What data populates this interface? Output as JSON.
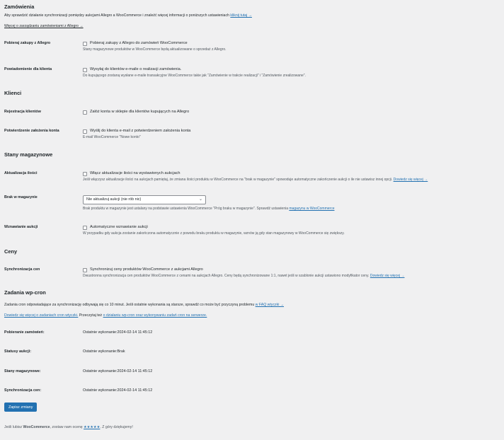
{
  "orders": {
    "title": "Zamówienia",
    "desc": "Aby sprawdzić działanie synchronizacji pomiędzy aukcjami Allegro a WooCommerce i znaleźć więcej informacji o poniższych ustawieniach",
    "desc_link": "kliknij tutaj →",
    "more_link": "Więcej o zarządzaniu zamówieniami z Allegro →",
    "fetch": {
      "label": "Pobieraj zakupy z Allegro",
      "checkbox_label": "Pobieraj zakupy z Allegro do zamówień WooCommerce",
      "help": "Stany magazynowe produktów w WooCommerce będą aktualizowane o sprzedaż z Allegro."
    },
    "notify": {
      "label": "Powiadomienie dla klienta",
      "checkbox_label": "Wysyłaj do klientów e-maile o realizacji zamówienia.",
      "help": "Do kupującego zostaną wysłane e-maile transakcyjne WooCommerce takie jak \"Zamówienie w trakcie realizacji\" i \"Zamówienie zrealizowane\"."
    }
  },
  "clients": {
    "title": "Klienci",
    "register": {
      "label": "Rejestracja klientów",
      "checkbox_label": "Załóż konta w sklepie dla klientów kupujących na Allegro"
    },
    "confirm": {
      "label": "Potwierdzenie założenia konta",
      "checkbox_label": "Wyślij do klienta e-mail z potwierdzeniem założenia konta",
      "help": "E-mail WooCommerce \"Nowe konto\""
    }
  },
  "stock": {
    "title": "Stany magazynowe",
    "update": {
      "label": "Aktualizacja ilości",
      "checkbox_label": "Włącz aktualizacje ilości na wystawionych aukcjach",
      "help": "Jeśli włączysz aktualizacje ilości na aukcjach pamiętaj, że zmiana ilości produktu w WooCommerce na \"brak w magazynie\" spowoduje automatyczne zakończenie aukcji o ile nie ustawisz innej opcji.",
      "help_link": "Dowiedz się więcej →"
    },
    "out_of_stock": {
      "label": "Brak w magazynie",
      "select_value": "Nie aktualizuj aukcji (nie rób nic)",
      "help": "Brak produktu w magazynie jest ustalany na podstawie ustawienia WooCommerce \"Próg braku w magazynie\". Sprawdź ustawienia",
      "help_link": "magazynu w WooCommerce"
    },
    "resume": {
      "label": "Wznawianie aukcji",
      "checkbox_label": "Automatyczne wznawianie aukcji",
      "help": "W przypadku gdy aukcja zostanie zakończona automatycznie z powodu braku produktu w magazynie, wznów ją gdy stan magazynowy w WooCommerce się zwiększy."
    }
  },
  "prices": {
    "title": "Ceny",
    "sync": {
      "label": "Synchronizacja cen",
      "checkbox_label": "Synchronizuj ceny produktów WooCommerce z aukcjami Allegro",
      "help": "Dwustronna synchronizacja cen produktów WooCommerce z cenami na aukcjach Allegro. Ceny będą synchronizowane 1:1, nawet jeśli w szablonie aukcji ustawiono modyfikator ceny.",
      "help_link": "Dowiedz się więcej →"
    }
  },
  "cron": {
    "title": "Zadania wp-cron",
    "desc": "Zadania cron odpowiadające za synchronizację odbywają się co 10 minut. Jeśli ostatnie wykonania są starsze, sprawdź co może być przyczyną problemu",
    "desc_link": "w FAQ wtyczki →",
    "link1": "Dowiedz się więcej o zadaniach cron wtyczki.",
    "test_prefix": "Przeczytaj też",
    "link2": "o działaniu wp-cron oraz wykonywaniu zadań cron na serwerze.",
    "rows": [
      {
        "label": "Pobieranie zamówień:",
        "value": "Ostatnie wykonanie:2024-02-14 11:45:12"
      },
      {
        "label": "Statusy aukcji:",
        "value": "Ostatnie wykonanie:Brak"
      },
      {
        "label": "Stany magazynowe:",
        "value": "Ostatnie wykonanie:2024-02-14 11:45:12"
      },
      {
        "label": "Synchronizacja cen:",
        "value": "Ostatnie wykonanie:2024-02-14 11:45:12"
      }
    ]
  },
  "save_button": "Zapisz zmiany",
  "footer": {
    "prefix": "Jeśli lubisz",
    "brand": "WooCommerce",
    "middle": ", zostaw nam ocenę",
    "stars": "★★★★★",
    "suffix": ". Z góry dziękujemy!"
  }
}
